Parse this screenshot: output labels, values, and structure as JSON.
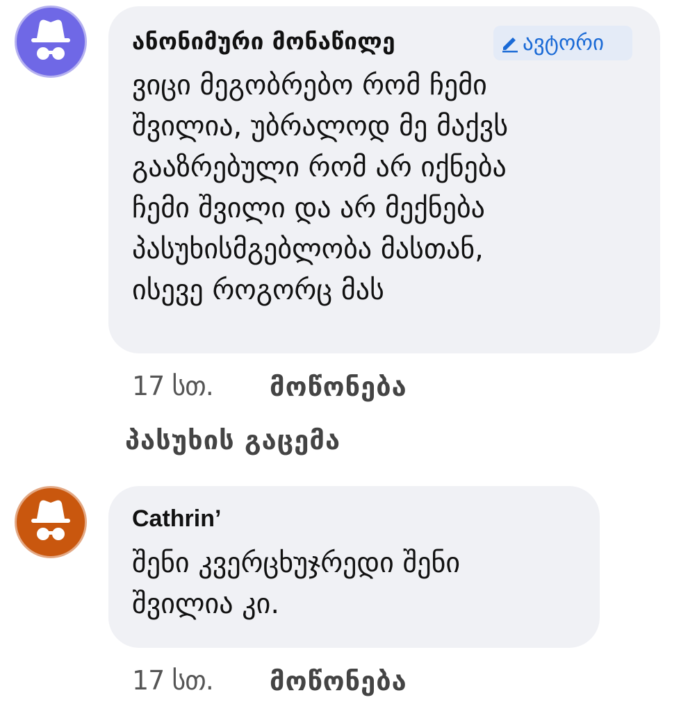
{
  "comments": [
    {
      "author": "ანონიმური მონაწილე",
      "badge": {
        "icon": "pencil-icon",
        "label": "ავტორი",
        "color": "#1a6ad6"
      },
      "avatar": {
        "icon": "incognito-icon",
        "color": "#6f68e6"
      },
      "text_lines": [
        "ვიცი მეგობრებო რომ ჩემი",
        "შვილია, უბრალოდ მე მაქვს",
        "გააზრებული რომ არ იქნება",
        "ჩემი შვილი და არ მექნება",
        "პასუხისმგებლობა მასთან,",
        "ისევე როგორც მას"
      ],
      "time": "17 სთ.",
      "like_label": "მოწონება",
      "reply_label": "პასუხის გაცემა"
    },
    {
      "author": "Cathrin’",
      "avatar": {
        "icon": "incognito-icon",
        "color": "#c9570e"
      },
      "text_lines": [
        "შენი კვერცხუჯრედი შენი",
        "შვილია კი."
      ],
      "time": "17 სთ.",
      "like_label": "მოწონება"
    }
  ],
  "colors": {
    "bubble_background": "#f0f1f5",
    "link_blue": "#1a6ad6"
  }
}
